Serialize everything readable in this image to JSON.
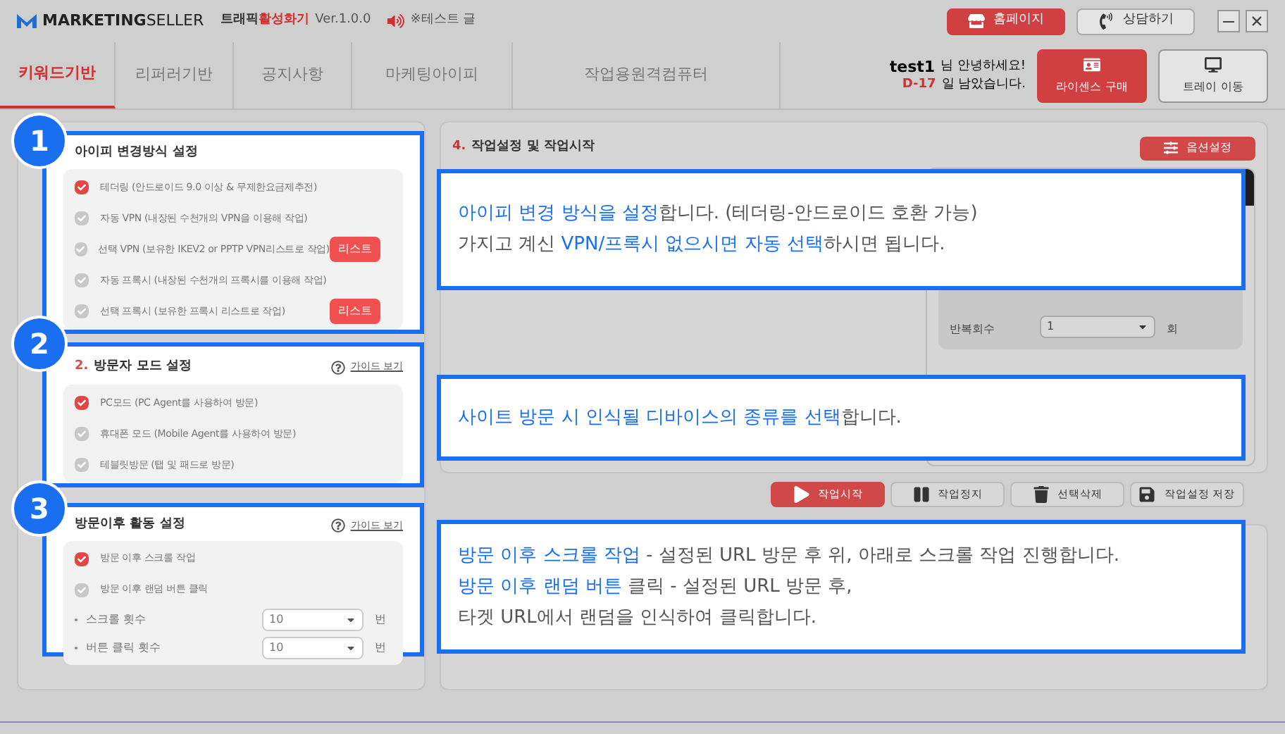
{
  "header": {
    "logo": "**MARKETING**SELLER",
    "product": [
      {
        "text": "트래픽",
        "highlight": false
      },
      {
        "text": "활성화기",
        "highlight": true
      }
    ],
    "version": "Ver.1.0.0",
    "notice": "※테스트 글",
    "buttons": [
      {
        "label": "홈페이지",
        "kind": "home"
      },
      {
        "label": "상담하기",
        "kind": "call"
      }
    ]
  },
  "tabs": [
    {
      "label": "키워드기반",
      "selected": true
    },
    {
      "label": "리퍼러기반",
      "selected": false
    },
    {
      "label": "공지사항",
      "selected": false
    },
    {
      "label": "마케팅아이피",
      "selected": false
    },
    {
      "label": "작업용원격컴퓨터",
      "selected": false
    }
  ],
  "user": {
    "name": "test1",
    "greeting": "님 안녕하세요!",
    "days": "D-17",
    "days_suffix": "일 남았습니다.",
    "buttons": [
      {
        "label": "라이센스 구매",
        "kind": "license"
      },
      {
        "label": "트레이 이동",
        "kind": "tray"
      }
    ]
  },
  "sections": [
    {
      "badge": "1",
      "title": "아이피 변경방식 설정",
      "items": [
        {
          "kind": "checkbox",
          "label": "테더링 (안드로이드 9.0 이상 & 무제한요금제추전)",
          "checked": true
        },
        {
          "kind": "checkbox",
          "label": "자동 VPN (내장된 수천개의 VPN을 이용해 작업)",
          "checked": false
        },
        {
          "kind": "checkbox",
          "label": "선택 VPN (보유한 IKEV2 or PPTP VPN리스트로 작업)",
          "checked": false,
          "button": "리스트"
        },
        {
          "kind": "checkbox",
          "label": "자동 프록시 (내장된 수천개의 프록시를 이용해 작업)",
          "checked": false
        },
        {
          "kind": "checkbox",
          "label": "선택 프록시 (보유한 프록시 리스트로 작업)",
          "checked": false,
          "button": "리스트"
        }
      ]
    },
    {
      "badge": "2",
      "number": "2.",
      "title": "방문자 모드 설정",
      "guide": "가이드 보기",
      "items": [
        {
          "kind": "checkbox",
          "label": "PC모드 (PC Agent를 사용하여 방문)",
          "checked": true
        },
        {
          "kind": "checkbox",
          "label": "휴대폰 모드 (Mobile Agent를 사용하여 방문)",
          "checked": false
        },
        {
          "kind": "checkbox",
          "label": "테블릿방문 (탭 및 패드로 방문)",
          "checked": false
        }
      ]
    },
    {
      "badge": "3",
      "title": "방문이후 활동 설정",
      "guide": "가이드 보기",
      "items": [
        {
          "kind": "checkbox",
          "label": "방문 이후 스크롤 작업",
          "checked": true
        },
        {
          "kind": "checkbox",
          "label": "방문 이후 랜덤 버튼 클릭",
          "checked": false
        },
        {
          "kind": "select",
          "label": "스크롤 횟수",
          "value": "10",
          "unit": "번"
        },
        {
          "kind": "select",
          "label": "버튼 클릭 횟수",
          "value": "10",
          "unit": "번"
        }
      ]
    }
  ],
  "work": {
    "number": "4.",
    "title": "작업설정 및 작업시작",
    "option_button": "옵션설정",
    "repeat": {
      "label": "반복회수",
      "value": "1",
      "unit": "회"
    },
    "actions": [
      {
        "label": "작업시작",
        "kind": "start"
      },
      {
        "label": "작업정지",
        "kind": "stop"
      },
      {
        "label": "선택삭제",
        "kind": "delete"
      },
      {
        "label": "작업설정 저장",
        "kind": "save"
      }
    ]
  },
  "callouts": [
    {
      "lines": [
        [
          {
            "text": "아이피 변경 방식을 설정",
            "highlight": true
          },
          {
            "text": "합니다. (테더링-안드로이드 호환 가능)",
            "highlight": false
          }
        ],
        [
          {
            "text": "가지고 계신 ",
            "highlight": false
          },
          {
            "text": "VPN/프록시 없으시면 자동 선택",
            "highlight": true
          },
          {
            "text": "하시면 됩니다.",
            "highlight": false
          }
        ]
      ]
    },
    {
      "lines": [
        [
          {
            "text": "사이트 방문 시 인식될 디바이스의 종류를 선택",
            "highlight": true
          },
          {
            "text": "합니다.",
            "highlight": false
          }
        ]
      ]
    },
    {
      "lines": [
        [
          {
            "text": "방문 이후 스크롤 작업",
            "highlight": true
          },
          {
            "text": " - 설정된 URL 방문 후 위, 아래로 스크롤 작업 진행합니다.",
            "highlight": false
          }
        ],
        [
          {
            "text": "방문 이후 랜덤 버튼",
            "highlight": true
          },
          {
            "text": " 클릭 - 설정된 URL 방문 후,",
            "highlight": false
          }
        ],
        [
          {
            "text": "타겟 URL에서 랜덤을 인식하여 클릭합니다.",
            "highlight": false
          }
        ]
      ]
    }
  ]
}
